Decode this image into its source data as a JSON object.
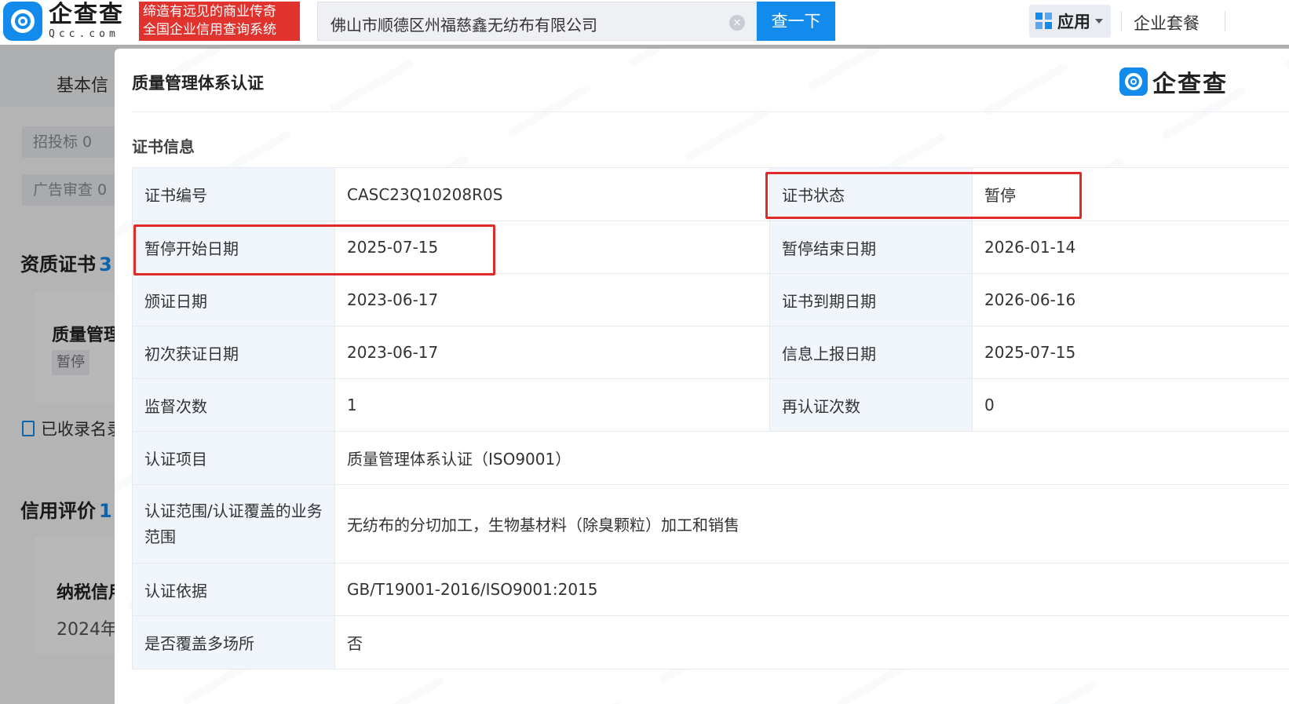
{
  "topbar": {
    "logo_cn": "企查查",
    "logo_en": "Qcc.com",
    "slogan_line1": "缔造有远见的商业传奇",
    "slogan_line2": "全国企业信用查询系统",
    "search_value": "佛山市顺德区州福慈鑫无纺布有限公司",
    "clear_icon": "×",
    "search_button": "查一下",
    "apps_label": "应用",
    "package_label": "企业套餐"
  },
  "background": {
    "tab_basic": "基本信",
    "chip_bidding": "招投标 0",
    "chip_ad": "广告审查 0",
    "qual_heading": "资质证书",
    "qual_count": "3",
    "card_title": "质量管理",
    "card_badge": "暂停",
    "collected_link": "已收录名录",
    "credit_heading": "信用评价",
    "credit_count": "1",
    "tax_title": "纳税信用",
    "tax_year": "2024年"
  },
  "modal": {
    "title": "质量管理体系认证",
    "logo_text": "企查查",
    "section_title": "证书信息",
    "rows": [
      {
        "k1": "证书编号",
        "v1": "CASC23Q10208R0S",
        "k2": "证书状态",
        "v2": "暂停"
      },
      {
        "k1": "暂停开始日期",
        "v1": "2025-07-15",
        "k2": "暂停结束日期",
        "v2": "2026-01-14"
      },
      {
        "k1": "颁证日期",
        "v1": "2023-06-17",
        "k2": "证书到期日期",
        "v2": "2026-06-16"
      },
      {
        "k1": "初次获证日期",
        "v1": "2023-06-17",
        "k2": "信息上报日期",
        "v2": "2025-07-15"
      },
      {
        "k1": "监督次数",
        "v1": "1",
        "k2": "再认证次数",
        "v2": "0"
      }
    ],
    "wide_rows": [
      {
        "k": "认证项目",
        "v": "质量管理体系认证（ISO9001）"
      },
      {
        "k": "认证范围/认证覆盖的业务范围",
        "v": "无纺布的分切加工，生物基材料（除臭颗粒）加工和销售"
      },
      {
        "k": "认证依据",
        "v": "GB/T19001-2016/ISO9001:2015"
      },
      {
        "k": "是否覆盖多场所",
        "v": "否"
      }
    ]
  },
  "colors": {
    "brand_blue": "#128bed",
    "slogan_red": "#e0332e",
    "highlight_red": "#e02a2a",
    "key_cell_bg": "#f1f6fd"
  }
}
